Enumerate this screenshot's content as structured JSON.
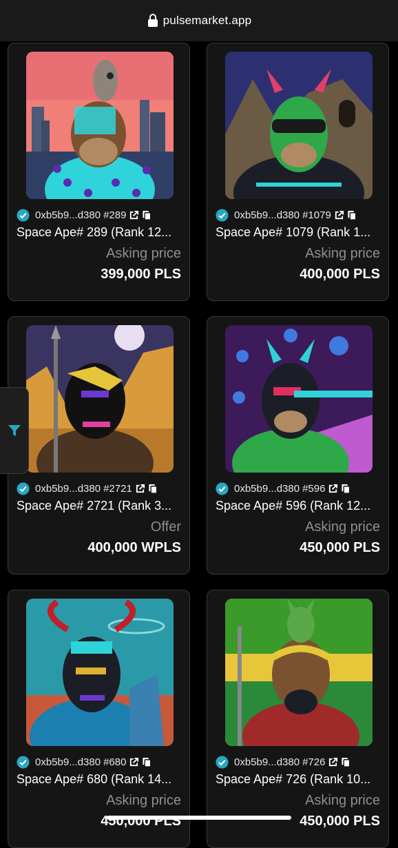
{
  "browser": {
    "domain": "pulsemarket.app"
  },
  "colors": {
    "verified": "#2aa6c2",
    "filter": "#2aa6c2"
  },
  "cards": [
    {
      "address": "0xb5b9...d380",
      "token": "#289",
      "name": "Space Ape# 289 (Rank 12...",
      "label": "Asking price",
      "price": "399,000 PLS"
    },
    {
      "address": "0xb5b9...d380",
      "token": "#1079",
      "name": "Space Ape# 1079 (Rank 1...",
      "label": "Asking price",
      "price": "400,000 PLS"
    },
    {
      "address": "0xb5b9...d380",
      "token": "#2721",
      "name": "Space Ape# 2721 (Rank 3...",
      "label": "Offer",
      "price": "400,000 WPLS"
    },
    {
      "address": "0xb5b9...d380",
      "token": "#596",
      "name": "Space Ape# 596 (Rank 12...",
      "label": "Asking price",
      "price": "450,000 PLS"
    },
    {
      "address": "0xb5b9...d380",
      "token": "#680",
      "name": "Space Ape# 680 (Rank 14...",
      "label": "Asking price",
      "price": "450,000 PLS"
    },
    {
      "address": "0xb5b9...d380",
      "token": "#726",
      "name": "Space Ape# 726 (Rank 10...",
      "label": "Asking price",
      "price": "450,000 PLS"
    }
  ]
}
